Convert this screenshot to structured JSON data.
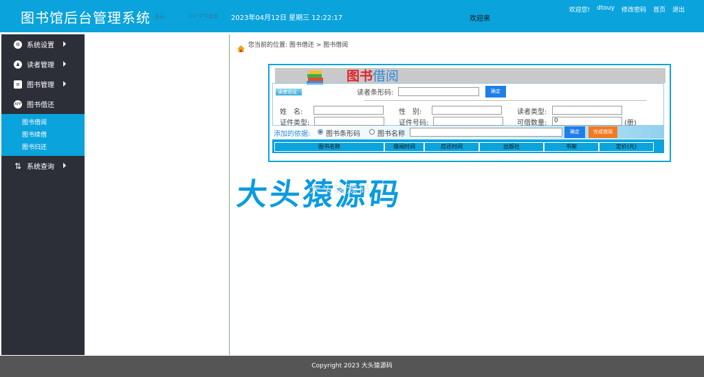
{
  "header": {
    "app_title": "图书馆后台管理系统",
    "weather_a": "多云",
    "weather_b": "11~2°C",
    "weather_c": "北京",
    "datetime": "2023年04月12日 星期三 12:22:17",
    "welcome_center": "欢迎来",
    "links": {
      "welcome": "欢迎您!",
      "user": "dtouy",
      "change_password": "修改密码",
      "home": "首页",
      "logout": "退出"
    }
  },
  "sidebar": {
    "items": [
      {
        "label": "系统设置",
        "icon": "gear-icon"
      },
      {
        "label": "读者管理",
        "icon": "reader-icon"
      },
      {
        "label": "图书管理",
        "icon": "books-icon"
      },
      {
        "label": "图书借还",
        "icon": "app-icon"
      },
      {
        "label": "系统查询",
        "icon": "sort-icon"
      }
    ],
    "subitems": [
      "图书借阅",
      "图书续借",
      "图书归还"
    ]
  },
  "breadcrumb": {
    "prefix": "您当前的位置:",
    "level1": "图书借还",
    "separator": ">",
    "level2": "图书借阅"
  },
  "panel": {
    "banner_red": "图书",
    "banner_blue": "借阅",
    "reader_tag": "读者验证",
    "barcode_label": "读者条形码:",
    "confirm_button": "确定",
    "name_label": "姓　名:",
    "gender_label": "性　别:",
    "reader_type_label": "读者类型:",
    "id_type_label": "证件类型:",
    "id_number_label": "证件号码:",
    "borrowable_label": "可借数量:",
    "borrowable_value": "0",
    "unit": "(册)",
    "add_basis_label": "添加的依据:",
    "radio_barcode": "图书条形码",
    "radio_name": "图书名称",
    "confirm_button_2": "确定",
    "finish_button": "完成借阅",
    "columns": [
      "图书名称",
      "借阅时间",
      "应还时间",
      "出版社",
      "书架",
      "定价(元)"
    ]
  },
  "watermark": {
    "big": "大头猿源码",
    "small": "大头猿源码"
  },
  "footer": {
    "copyright": "Copyright 2023 大头猿源码"
  },
  "colors": {
    "header": "#0aa3dc",
    "sidebar": "#2c2f38",
    "active_sub": "#0aa3dc",
    "footer": "#555555"
  }
}
